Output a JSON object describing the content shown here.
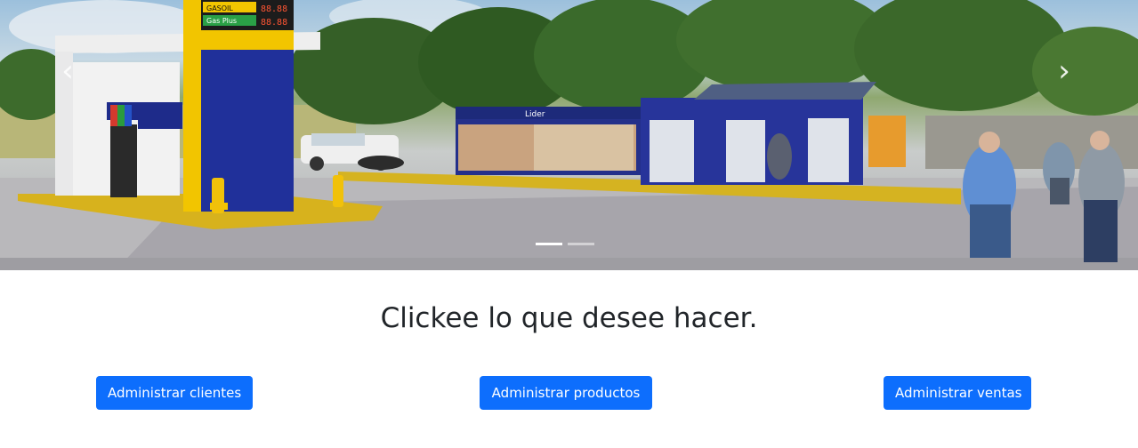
{
  "carousel": {
    "image": "gas-station-storefront-rendering",
    "prev_icon": "chevron-left-icon",
    "next_icon": "chevron-right-icon",
    "prev_glyph": "‹",
    "next_glyph": "›",
    "slides": 2,
    "active_slide": 1,
    "signage": {
      "fuel_1": "GASOIL",
      "fuel_2": "Gas Plus",
      "price": "88.88",
      "brand": "Lider"
    }
  },
  "main": {
    "heading": "Clickee lo que desee hacer.",
    "buttons": [
      {
        "label": "Administrar clientes"
      },
      {
        "label": "Administrar productos"
      },
      {
        "label": "Administrar ventas"
      }
    ]
  },
  "colors": {
    "primary": "#0d6efd",
    "text": "#212529",
    "station_blue": "#1f2f8f",
    "station_yellow": "#f3c400"
  }
}
